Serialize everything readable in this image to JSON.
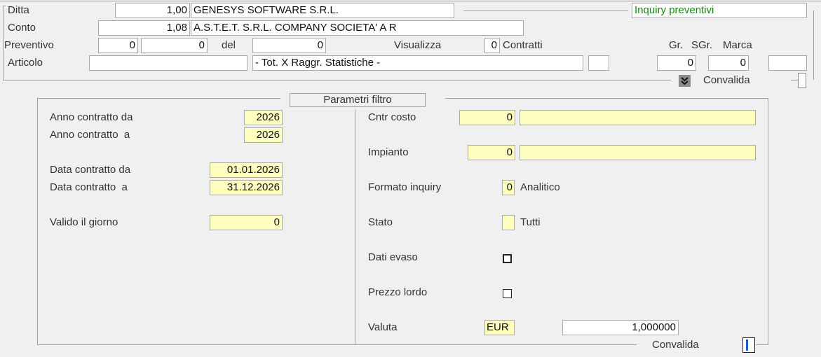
{
  "header": {
    "ditta": {
      "label": "Ditta",
      "code": "1,00",
      "name": "GENESYS SOFTWARE S.R.L."
    },
    "conto": {
      "label": "Conto",
      "code": "1,08",
      "name": "A.S.T.E.T. S.R.L. COMPANY SOCIETA' A R"
    },
    "preventivo": {
      "label": "Preventivo",
      "from1": "0",
      "from2": "0",
      "del_label": "del",
      "to": "0"
    },
    "visualizza": {
      "label": "Visualizza",
      "value": "0",
      "suffix": "Contratti"
    },
    "articolo": {
      "label": "Articolo",
      "code": "",
      "desc": "- Tot. X Raggr. Statistiche -",
      "extra": ""
    },
    "gr": {
      "label": "Gr.",
      "value": "0"
    },
    "sgr": {
      "label": "SGr.",
      "value": "0"
    },
    "marca": {
      "label": "Marca",
      "value": ""
    },
    "title": "Inquiry preventivi",
    "convalida_label": "Convalida"
  },
  "filter": {
    "title": "Parametri filtro",
    "anno_da": {
      "label": "Anno contratto da",
      "value": "2026"
    },
    "anno_a": {
      "label": "Anno contratto  a",
      "value": "2026"
    },
    "data_da": {
      "label": "Data contratto da",
      "value": "01.01.2026"
    },
    "data_a": {
      "label": "Data contratto  a",
      "value": "31.12.2026"
    },
    "valido": {
      "label": "Valido il giorno",
      "value": "0"
    },
    "cntr_costo": {
      "label": "Cntr costo",
      "value": "0",
      "desc": ""
    },
    "impianto": {
      "label": "Impianto",
      "value": "0",
      "desc": ""
    },
    "formato": {
      "label": "Formato inquiry",
      "value": "0",
      "desc": "Analitico"
    },
    "stato": {
      "label": "Stato",
      "value": "",
      "desc": "Tutti"
    },
    "dati_evaso": {
      "label": "Dati evaso",
      "checked": false
    },
    "prezzo_lordo": {
      "label": "Prezzo lordo",
      "checked": false
    },
    "valuta": {
      "label": "Valuta",
      "code": "EUR",
      "rate": "1,000000"
    },
    "convalida_label": "Convalida"
  },
  "icons": {
    "expand": "double-chevron-down-icon"
  },
  "colors": {
    "title_text": "#138a13",
    "field_yellow": "#ffffc0",
    "accent_blue": "#1a64c8"
  }
}
